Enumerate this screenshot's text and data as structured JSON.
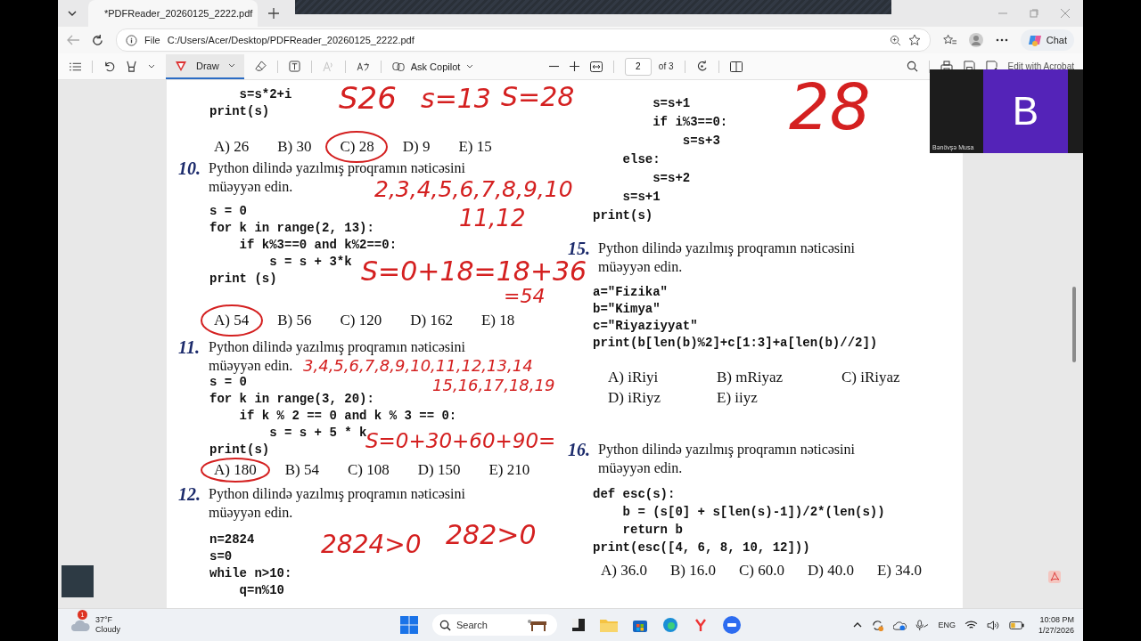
{
  "browser": {
    "tab_title": "*PDFReader_20260125_2222.pdf",
    "address_prefix": "File",
    "url": "C:/Users/Acer/Desktop/PDFReader_20260125_2222.pdf",
    "chat_label": "Chat"
  },
  "pdf_toolbar": {
    "draw_label": "Draw",
    "draw_selected": true,
    "copilot_label": "Ask Copilot",
    "page_number": "2",
    "page_total": "of 3",
    "acrobat_label": "Edit with Acrobat"
  },
  "page": {
    "left_column": [
      {
        "kind": "code",
        "lines": [
          "    s=s*2+i",
          "print(s)"
        ]
      },
      {
        "kind": "options",
        "items": [
          "A) 26",
          "B) 30",
          "C) 28",
          "D) 9",
          "E) 15"
        ]
      },
      {
        "kind": "question",
        "number": "10.",
        "lines": [
          "Python dilində yazılmış proqramın nəticəsini",
          "müəyyən edin."
        ]
      },
      {
        "kind": "code",
        "lines": [
          "s = 0",
          "for k in range(2, 13):",
          "    if k%3==0 and k%2==0:",
          "        s = s + 3*k",
          "print (s)"
        ]
      },
      {
        "kind": "options",
        "items": [
          "A) 54",
          "B) 56",
          "C) 120",
          "D) 162",
          "E) 18"
        ]
      },
      {
        "kind": "question",
        "number": "11.",
        "lines": [
          "Python dilində yazılmış proqramın nəticəsini",
          "müəyyən edin."
        ]
      },
      {
        "kind": "code",
        "lines": [
          "s = 0",
          "for k in range(3, 20):",
          "    if k % 2 == 0 and k % 3 == 0:",
          "        s = s + 5 * k",
          "print(s)"
        ]
      },
      {
        "kind": "options",
        "items": [
          "A) 180",
          "B) 54",
          "C) 108",
          "D) 150",
          "E) 210"
        ]
      },
      {
        "kind": "question",
        "number": "12.",
        "lines": [
          "Python dilində yazılmış proqramın nəticəsini",
          "müəyyən edin."
        ]
      },
      {
        "kind": "code",
        "lines": [
          "n=2824",
          "s=0",
          "while n>10:",
          "    q=n%10"
        ]
      }
    ],
    "right_column": [
      {
        "kind": "code",
        "lines": [
          "        s=s+1",
          "        if i%3==0:",
          "            s=s+3",
          "    else:",
          "        s=s+2",
          "    s=s+1",
          "print(s)"
        ]
      },
      {
        "kind": "question",
        "number": "15.",
        "lines": [
          "Python dilində yazılmış proqramın nəticəsini",
          "müəyyən edin."
        ]
      },
      {
        "kind": "code",
        "lines": [
          "a=\"Fizika\"",
          "b=\"Kimya\"",
          "c=\"Riyaziyyat\"",
          "print(b[len(b)%2]+c[1:3]+a[len(b)//2])"
        ]
      },
      {
        "kind": "options_grid",
        "items": [
          "A) iRiyi",
          "B) mRiyaz",
          "C) iRiyaz",
          "D) iRiyz",
          "E) iiyz"
        ]
      },
      {
        "kind": "question",
        "number": "16.",
        "lines": [
          "Python dilində yazılmış proqramın nəticəsini",
          "müəyyən edin."
        ]
      },
      {
        "kind": "code",
        "lines": [
          "def esc(s):",
          "    b = (s[0] + s[len(s)-1])/2*(len(s))",
          "    return b",
          "print(esc([4, 6, 8, 10, 12]))"
        ]
      },
      {
        "kind": "options",
        "items": [
          "A) 36.0",
          "B) 16.0",
          "C) 60.0",
          "D) 40.0",
          "E) 34.0"
        ]
      }
    ],
    "ink_notes": [
      "S26",
      "s=13",
      "S=28",
      "28",
      "2,3,4,5,6,7,8,9,10",
      "11,12",
      "S=0+18=18+36",
      "=54",
      "3,4,5,6,7,8,9,10,11,12,13,14",
      "15,16,17,18,19",
      "S=0+30+60+90=",
      "2824>0",
      "282>0"
    ]
  },
  "video_tile": {
    "initial": "B",
    "name": "Bənövşə Musa"
  },
  "taskbar": {
    "weather_badge": "1",
    "temperature": "37°F",
    "condition": "Cloudy",
    "search_placeholder": "Search",
    "language": "ENG",
    "time": "10:08 PM",
    "date": "1/27/2026"
  }
}
